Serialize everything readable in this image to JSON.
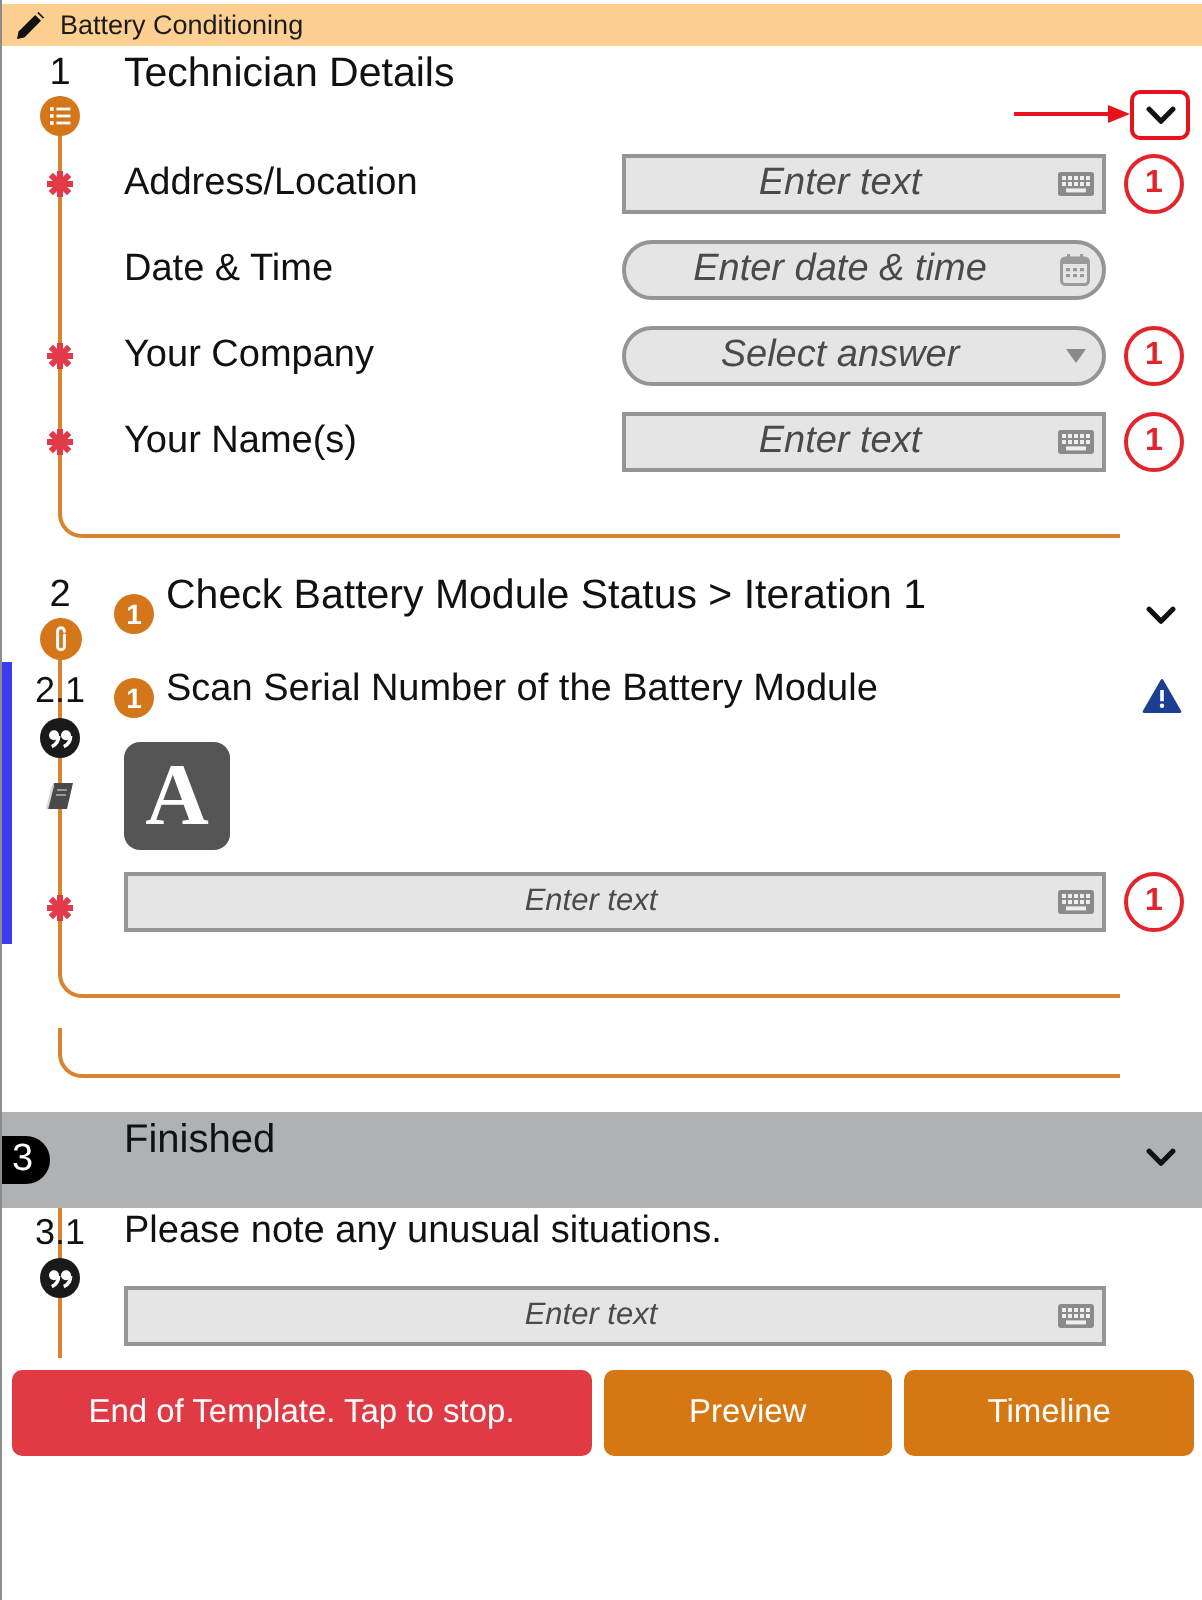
{
  "header": {
    "title": "Battery Conditioning"
  },
  "sections": [
    {
      "kind": "group",
      "number": "1",
      "title": "Technician Details",
      "expanded": true,
      "callout": true,
      "fields": [
        {
          "label": "Address/Location",
          "required": true,
          "kind": "text",
          "placeholder": "Enter text",
          "badge": "1"
        },
        {
          "label": "Date & Time",
          "required": false,
          "kind": "datetime",
          "placeholder": "Enter date & time"
        },
        {
          "label": "Your Company",
          "required": true,
          "kind": "select",
          "placeholder": "Select answer",
          "badge": "1"
        },
        {
          "label": "Your Name(s)",
          "required": true,
          "kind": "text",
          "placeholder": "Enter text",
          "badge": "1"
        }
      ]
    },
    {
      "kind": "repeat",
      "number": "2",
      "badge": "1",
      "title": "Check Battery Module Status > Iteration 1",
      "expanded": true,
      "callout": false,
      "questions": [
        {
          "kind": "text",
          "number": "2.1",
          "badge": "1",
          "title": "Scan Serial Number of the Battery Module",
          "selected": true,
          "warning": true,
          "instructions": true,
          "type_label": "A",
          "required": true,
          "field": {
            "kind": "text",
            "placeholder": "Enter text",
            "badge": "1"
          }
        }
      ]
    },
    {
      "kind": "final",
      "number": "3",
      "title": "Finished",
      "expanded": true,
      "callout": false,
      "questions": [
        {
          "kind": "text",
          "number": "3.1",
          "title": "Please note any unusual situations.",
          "selected": false,
          "warning": false,
          "instructions": false,
          "required": false,
          "field": {
            "kind": "text",
            "placeholder": "Enter text"
          }
        }
      ]
    }
  ],
  "buttons": [
    {
      "kind": "stop",
      "label": "End of Template. Tap to stop."
    },
    {
      "kind": "action",
      "label": "Preview"
    },
    {
      "kind": "action",
      "label": "Timeline"
    }
  ]
}
